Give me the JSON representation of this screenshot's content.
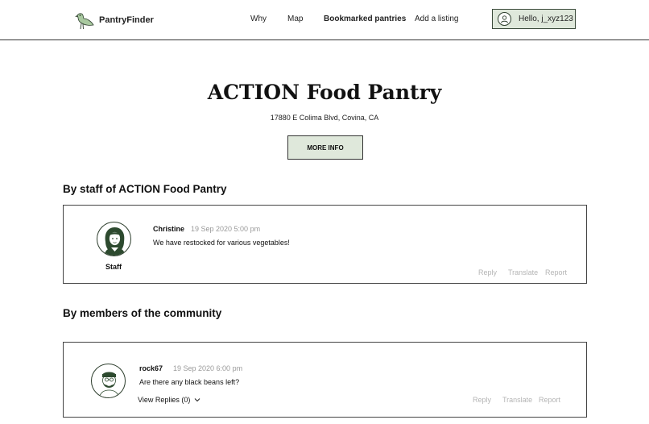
{
  "nav": {
    "brand": "PantryFinder",
    "links": [
      "Why",
      "Map",
      "Bookmarked pantries",
      "Add a listing"
    ],
    "user_greeting": "Hello, j_xyz123"
  },
  "pantry": {
    "name": "ACTION Food Pantry",
    "address": "17880 E Colima Blvd, Covina, CA",
    "more_info": "MORE INFO"
  },
  "staff_section": {
    "title": "By staff of ACTION Food Pantry",
    "post": {
      "author": "Christine",
      "time": "19 Sep 2020 5:00 pm",
      "message": "We have restocked for various vegetables!",
      "role": "Staff",
      "actions": [
        "Reply",
        "Translate",
        "Report"
      ]
    }
  },
  "community_section": {
    "title": "By members of the community",
    "post": {
      "author": "rock67",
      "time": "19 Sep 2020 6:00 pm",
      "message": "Are there any black beans left?",
      "view_replies": "View Replies (0)",
      "actions": [
        "Reply",
        "Translate",
        "Report"
      ]
    }
  },
  "colors": {
    "accent_bg": "#dfe8db",
    "avatar_green": "#2d4a2f",
    "muted_text": "#b5b5b5"
  },
  "icons": [
    "bird-logo-icon",
    "user-avatar-icon",
    "staff-avatar-icon",
    "member-avatar-icon",
    "chevron-down-icon"
  ]
}
